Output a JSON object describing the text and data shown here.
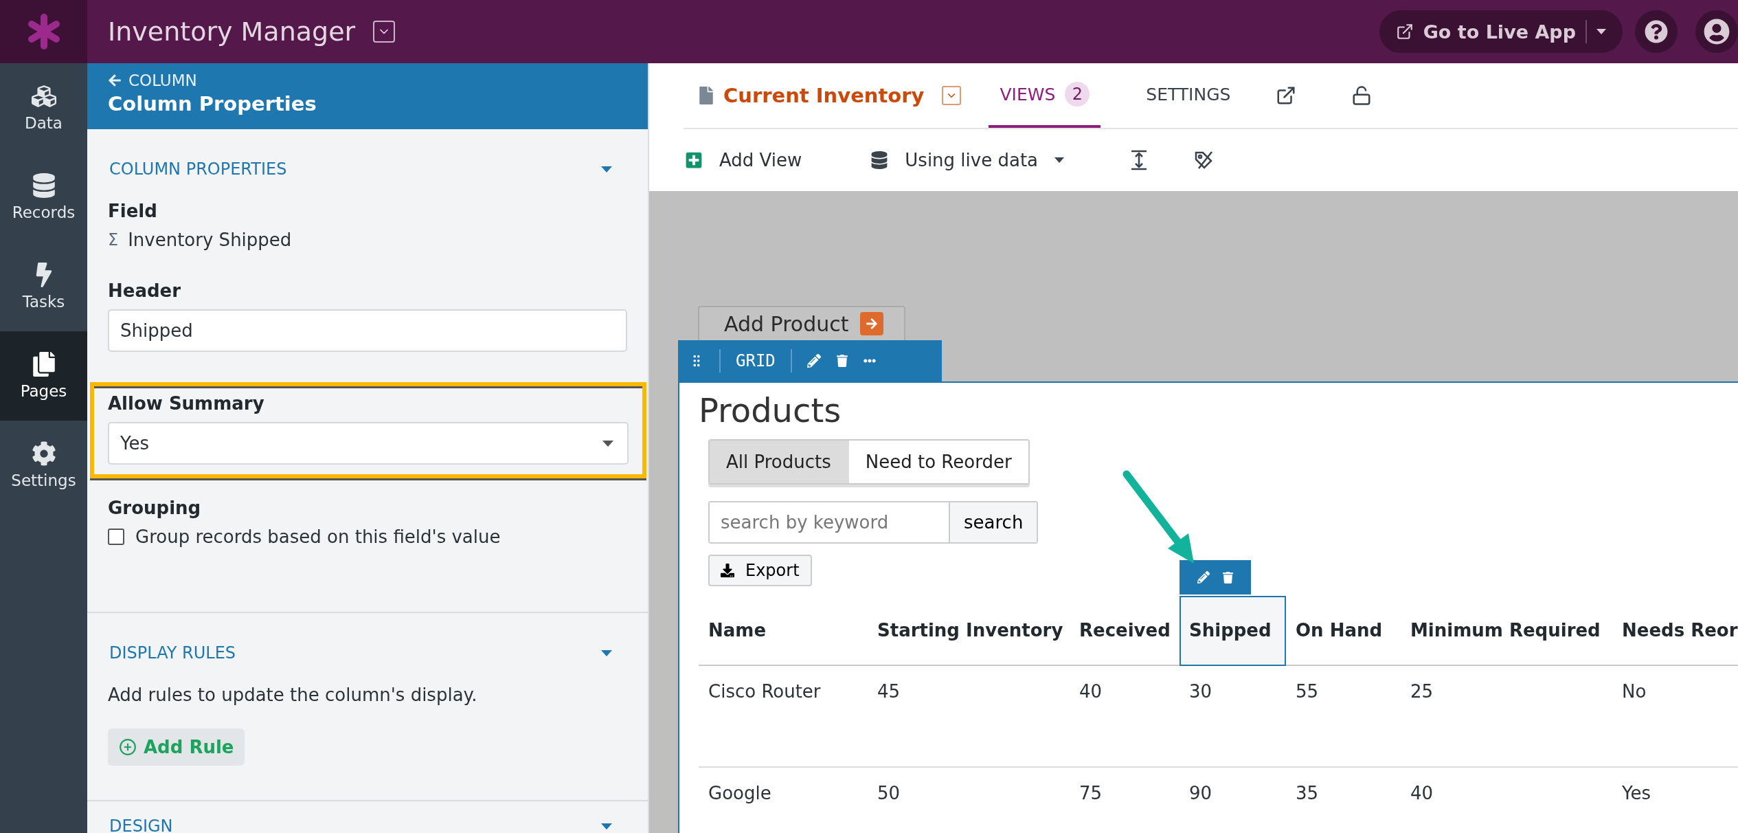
{
  "app": {
    "title": "Inventory Manager",
    "live_app_button": "Go to Live App"
  },
  "nav": [
    {
      "label": "Data",
      "selected": false
    },
    {
      "label": "Records",
      "selected": false
    },
    {
      "label": "Tasks",
      "selected": false
    },
    {
      "label": "Pages",
      "selected": true
    },
    {
      "label": "Settings",
      "selected": false
    }
  ],
  "panel": {
    "back_link": "COLUMN",
    "title": "Column Properties",
    "sections": [
      {
        "title": "COLUMN PROPERTIES",
        "expanded": true,
        "fields": [
          {
            "kind": "readonly",
            "label": "Field",
            "symbol": "Σ",
            "value": "Inventory Shipped"
          },
          {
            "kind": "text",
            "label": "Header",
            "value": "Shipped"
          },
          {
            "kind": "select",
            "label": "Allow Summary",
            "value": "Yes",
            "highlighted": true
          },
          {
            "kind": "checkbox",
            "label": "Grouping",
            "option": "Group records based on this field's value",
            "checked": false
          }
        ]
      },
      {
        "title": "DISPLAY RULES",
        "expanded": true,
        "text": "Add rules to update the column's display.",
        "button": "Add Rule"
      },
      {
        "title": "DESIGN",
        "expanded": true
      }
    ]
  },
  "page_header": {
    "page_name": "Current Inventory",
    "tabs": [
      {
        "label": "VIEWS",
        "badge": "2",
        "selected": true
      },
      {
        "label": "SETTINGS",
        "selected": false
      }
    ]
  },
  "toolbar": {
    "add_view": "Add View",
    "data_source": "Using live data"
  },
  "canvas": {
    "action_button": "Add Product",
    "element_type": "GRID",
    "grid_title": "Products",
    "filters": [
      {
        "label": "All Products",
        "selected": true
      },
      {
        "label": "Need to Reorder",
        "selected": false
      }
    ],
    "search": {
      "placeholder": "search by keyword",
      "button": "search"
    },
    "export": "Export",
    "table": {
      "columns": [
        {
          "label": "Name",
          "selected": false
        },
        {
          "label": "Starting Inventory",
          "selected": false
        },
        {
          "label": "Received",
          "selected": false
        },
        {
          "label": "Shipped",
          "selected": true
        },
        {
          "label": "On Hand",
          "selected": false
        },
        {
          "label": "Minimum Required",
          "selected": false
        },
        {
          "label": "Needs Reor",
          "selected": false
        }
      ],
      "rows": [
        [
          "Cisco Router",
          "45",
          "40",
          "30",
          "55",
          "25",
          "No"
        ],
        [
          "Google",
          "50",
          "75",
          "90",
          "35",
          "40",
          "Yes"
        ]
      ]
    }
  }
}
